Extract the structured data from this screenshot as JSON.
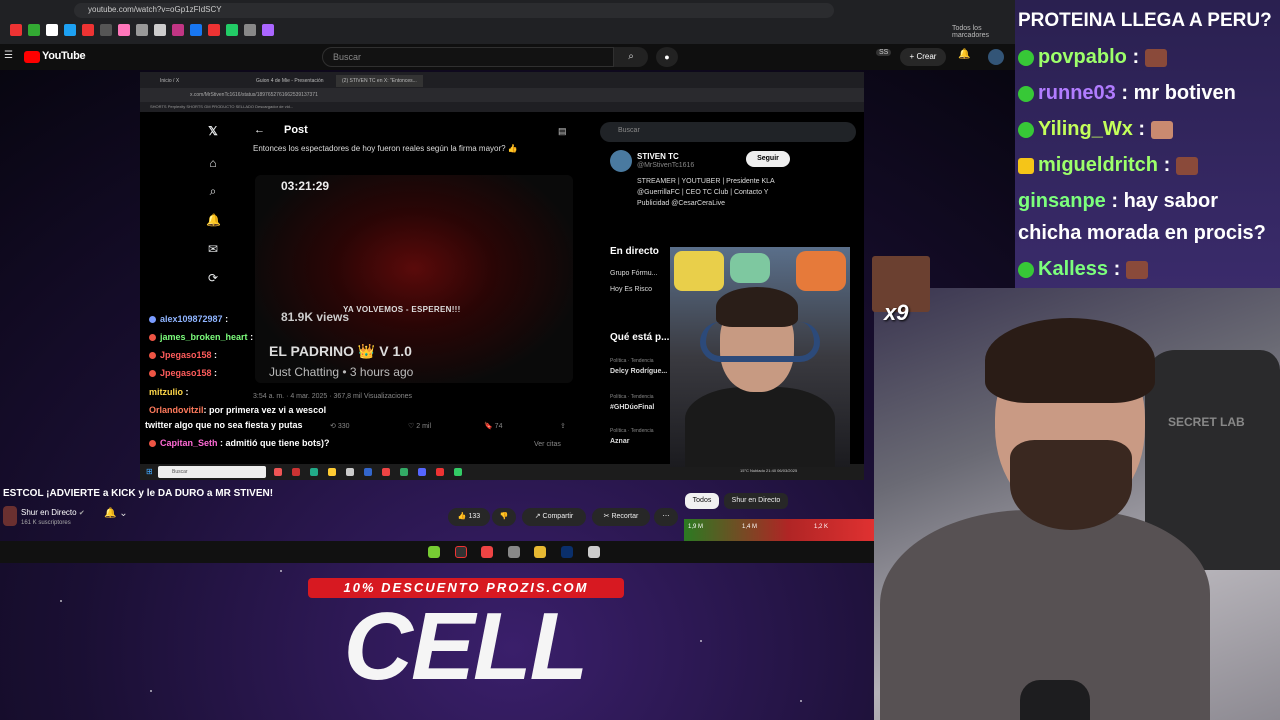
{
  "browser": {
    "url": "youtube.com/watch?v=oGp1zFIdSCY",
    "bookmarks_label": "Todos los marcadores"
  },
  "youtube": {
    "logo": "YouTube",
    "search_placeholder": "Buscar",
    "badge": "SS",
    "create_label": "Crear",
    "video_title": "ESTCOL ¡ADVIERTE a KICK y le DA DURO a MR STIVEN!",
    "channel_name": "Shur en Directo",
    "subscribers": "161 K suscriptores",
    "likes": "133",
    "share_label": "Compartir",
    "clip_label": "Recortar",
    "chips": [
      "Todos",
      "Shur en Directo"
    ],
    "rec_views": [
      "1,9 M",
      "1,4 M",
      "1,2 K"
    ]
  },
  "embedded": {
    "tabs": [
      "Inicio / X",
      "Guion 4 de Mie - Presentación",
      "(2) STIVEN TC en X: \"Entonces..."
    ],
    "url": "x.com/MrStivenTc1616/status/1897652761662539137371",
    "bookmarks": "SHORTS   Perplexity   SHORTS   GM   PRODUCTO SELLADO   Descargador de vid...",
    "post_header": "Post",
    "tweet_text": "Entonces los espectadores de hoy fueron reales según la firma mayor? 👍",
    "stream_time": "03:21:29",
    "stream_banner": "YA VOLVEMOS - ESPEREN!!!",
    "stream_views": "81.9K views",
    "stream_title": "EL PADRINO 👑 V 1.0",
    "stream_sub": "Just Chatting • 3 hours ago",
    "tweet_meta": "3:54 a. m. · 4 mar. 2025 · 367,8 mil Visualizaciones",
    "actions": [
      "330",
      "2 mil",
      "74"
    ],
    "ver_citas": "Ver citas",
    "search_placeholder": "Buscar",
    "profile": {
      "name": "STIVEN TC",
      "handle": "@MrStivenTc1616",
      "bio": "STREAMER | YOUTUBER | Presidente KLA @GuerrillaFC | CEO TC Club | Contacto Y Publicidad @CesarCeraLive",
      "follow": "Seguir"
    },
    "live_header": "En directo",
    "live_items": [
      "Grupo Fórmu...",
      "Hoy Es Risco"
    ],
    "trends_header": "Qué está p...",
    "trends": [
      {
        "cat": "Política · Tendencia",
        "name": "Delcy Rodrígue..."
      },
      {
        "cat": "Política · Tendencia",
        "name": "#GHDúoFinal"
      },
      {
        "cat": "Política · Tendencia",
        "name": "Aznar"
      }
    ],
    "taskbar_search": "Buscar",
    "taskbar_status": "15°C Nublado  21:40 06/03/2025"
  },
  "stream_chat": [
    {
      "user": "alex109872987",
      "msg": ":",
      "color": "#8fb4ff"
    },
    {
      "user": "james_broken_heart",
      "msg": ":",
      "color": "#7cfc7c"
    },
    {
      "user": "Jpegaso158",
      "msg": ":",
      "color": "#ff5c5c"
    },
    {
      "user": "Jpegaso158",
      "msg": ":",
      "color": "#ff5c5c"
    },
    {
      "user": "mitzulio",
      "msg": ":",
      "color": "#ffd84a"
    },
    {
      "user": "Orlandovitzil",
      "msg": ": por primera vez vi a wescol",
      "color": "#ff7a5c"
    },
    {
      "user": "",
      "msg": "twitter algo que no sea fiesta y putas",
      "color": "#fff"
    },
    {
      "user": "Capitan_Seth",
      "msg": ": admitió que tiene bots)?",
      "color": "#ff6ad5"
    }
  ],
  "main_chat": [
    {
      "user": "",
      "msg": "PROTEINA LLEGA A PERU?",
      "color": "#fff"
    },
    {
      "user": "povpablo",
      "msg": " :",
      "color": "#9dff6a"
    },
    {
      "user": "runne03",
      "msg": " : mr botiven",
      "color": "#b17cff"
    },
    {
      "user": "Yiling_Wx",
      "msg": " :",
      "color": "#c3ff5a"
    },
    {
      "user": "migueldritch",
      "msg": " :",
      "color": "#9dff6a"
    },
    {
      "user": "ginsanpe",
      "msg": " : hay sabor",
      "color": "#7cff7c"
    },
    {
      "user": "",
      "msg": "chicha morada en procis?",
      "color": "#fff"
    },
    {
      "user": "Kalless",
      "msg": " :",
      "color": "#7cff7c"
    }
  ],
  "emote_counter": "x9",
  "promo": {
    "band": "10% DESCUENTO PROZIS.COM",
    "big": "CELL"
  },
  "chair_text": "SECRET LAB",
  "colors": {
    "accent_red": "#d71921",
    "yt_red": "#ff0000",
    "chat_green": "#37c837"
  }
}
